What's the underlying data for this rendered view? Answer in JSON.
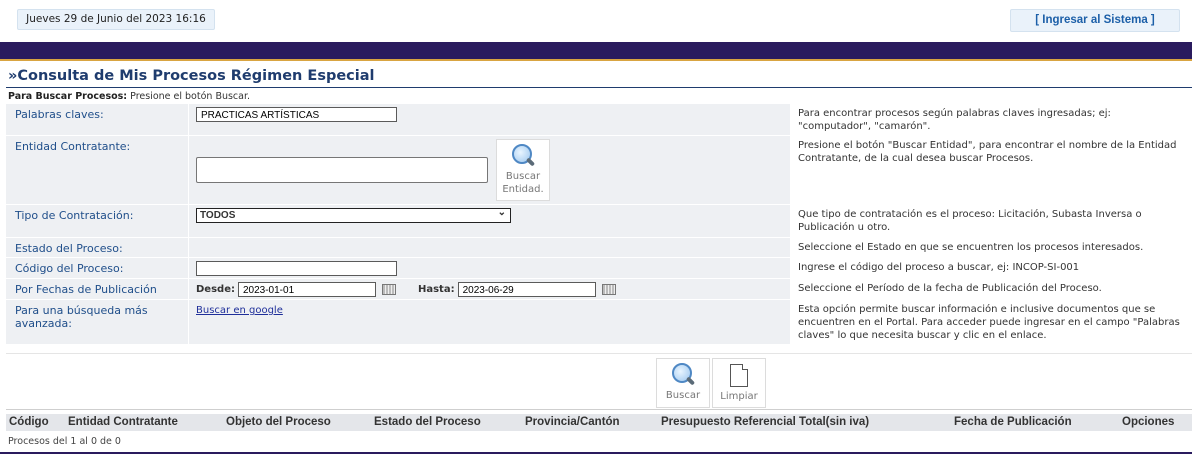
{
  "header": {
    "date_text": "Jueves 29 de Junio del 2023 16:16",
    "login_link": "[ Ingresar al Sistema ]"
  },
  "page_title": "»Consulta de Mis Procesos Régimen Especial",
  "hint": {
    "bold": "Para Buscar Procesos:",
    "text": " Presione el botón Buscar."
  },
  "form": {
    "keywords": {
      "label": "Palabras claves:",
      "value": "PRACTICAS ARTÍSTICAS",
      "help": "Para encontrar procesos según palabras claves ingresadas; ej: \"computador\", \"camarón\"."
    },
    "entity": {
      "label": "Entidad Contratante:",
      "button_label_1": "Buscar",
      "button_label_2": "Entidad.",
      "help": "Presione el botón \"Buscar Entidad\", para encontrar el nombre de la Entidad Contratante, de la cual desea buscar Procesos."
    },
    "contract_type": {
      "label": "Tipo de Contratación:",
      "selected": "TODOS",
      "help": "Que tipo de contratación es el proceso: Licitación, Subasta Inversa o Publicación u otro."
    },
    "status": {
      "label": "Estado del Proceso:",
      "help": "Seleccione el Estado en que se encuentren los procesos interesados."
    },
    "code": {
      "label": "Código del Proceso:",
      "value": "",
      "help": "Ingrese el código del proceso a buscar, ej: INCOP-SI-001"
    },
    "dates": {
      "label": "Por Fechas de Publicación",
      "from_label": "Desde:",
      "from_value": "2023-01-01",
      "to_label": "Hasta:",
      "to_value": "2023-06-29",
      "help": "Seleccione el Período de la fecha de Publicación del Proceso."
    },
    "advanced": {
      "label": "Para una búsqueda más avanzada:",
      "link": "Buscar en google",
      "help": "Esta opción permite buscar información e inclusive documentos que se encuentren en el Portal. Para acceder puede ingresar en el campo \"Palabras claves\" lo que necesita buscar y clic en el enlace."
    }
  },
  "actions": {
    "search": "Buscar",
    "clear": "Limpiar"
  },
  "results": {
    "columns": [
      "Código",
      "Entidad Contratante",
      "Objeto del Proceso",
      "Estado del Proceso",
      "Provincia/Cantón",
      "Presupuesto Referencial Total(sin iva)",
      "Fecha de Publicación",
      "Opciones"
    ],
    "summary": "Procesos del 1 al 0 de 0"
  },
  "colors": {
    "banner": "#2a1b5e",
    "accent_line": "#d9a441",
    "label_blue": "#1f4e8a",
    "title_blue": "#1f3c6e"
  },
  "icons": [
    "magnifier-icon",
    "calendar-icon",
    "document-icon",
    "chevron-down-icon"
  ]
}
